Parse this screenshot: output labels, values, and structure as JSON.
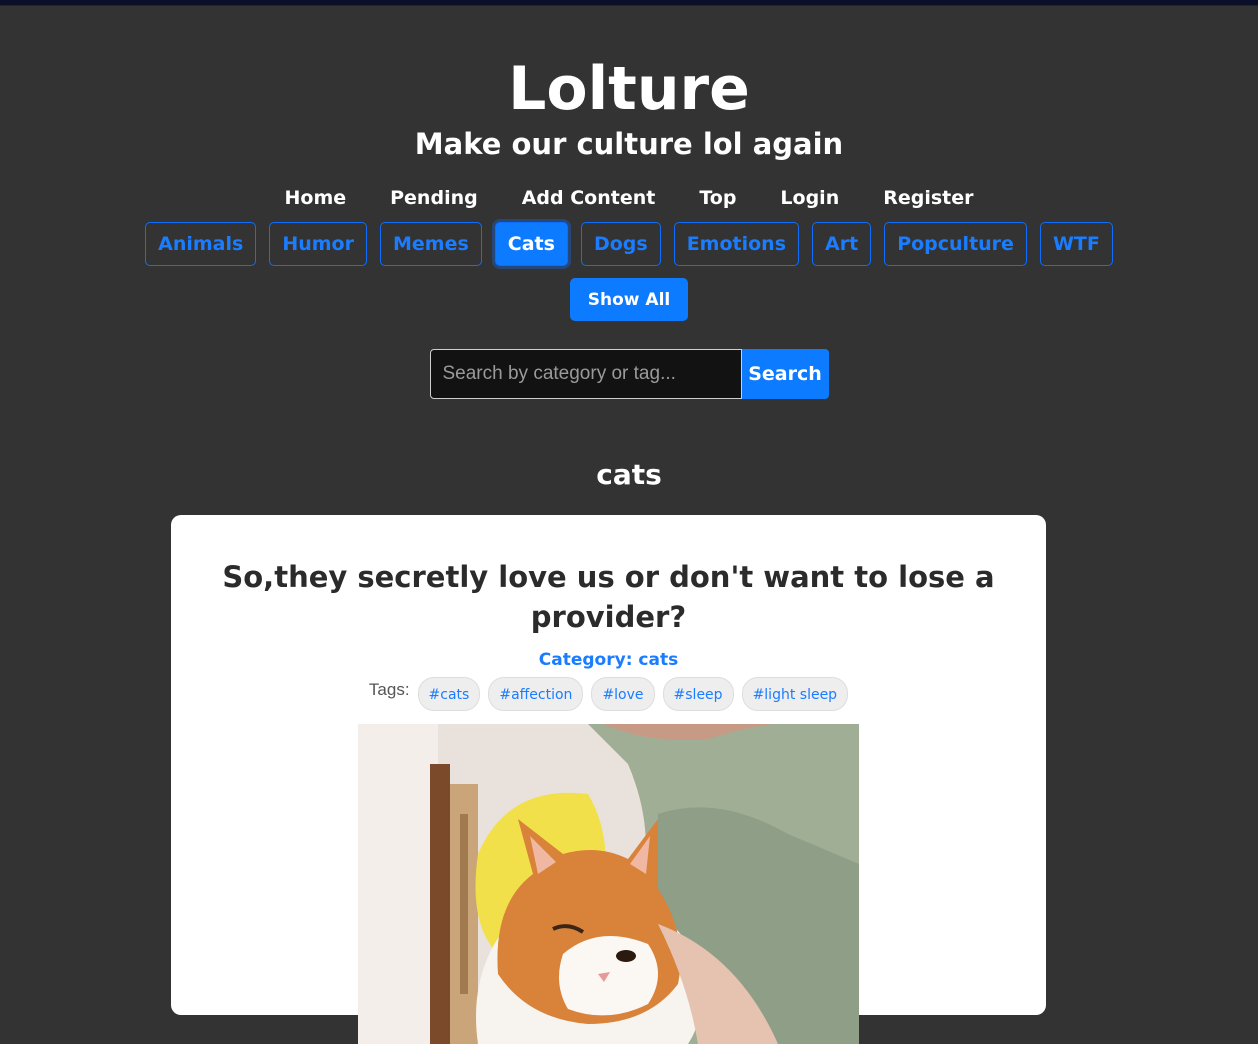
{
  "site": {
    "title": "Lolture",
    "tagline": "Make our culture lol again"
  },
  "nav": [
    {
      "label": "Home"
    },
    {
      "label": "Pending"
    },
    {
      "label": "Add Content"
    },
    {
      "label": "Top"
    },
    {
      "label": "Login"
    },
    {
      "label": "Register"
    }
  ],
  "categories": [
    {
      "label": "Animals",
      "active": false
    },
    {
      "label": "Humor",
      "active": false
    },
    {
      "label": "Memes",
      "active": false
    },
    {
      "label": "Cats",
      "active": true
    },
    {
      "label": "Dogs",
      "active": false
    },
    {
      "label": "Emotions",
      "active": false
    },
    {
      "label": "Art",
      "active": false
    },
    {
      "label": "Popculture",
      "active": false
    },
    {
      "label": "WTF",
      "active": false
    }
  ],
  "show_all_label": "Show All",
  "search": {
    "placeholder": "Search by category or tag...",
    "value": "",
    "button_label": "Search"
  },
  "section_heading": "cats",
  "post": {
    "title": "So,they secretly love us or don't want to lose a provider?",
    "category_text": "Category: cats",
    "tags_label": "Tags:",
    "tags": [
      "#cats",
      "#affection",
      "#love",
      "#sleep",
      "#light sleep"
    ]
  },
  "colors": {
    "background": "#333333",
    "accent": "#0d7bff",
    "card": "#ffffff"
  }
}
